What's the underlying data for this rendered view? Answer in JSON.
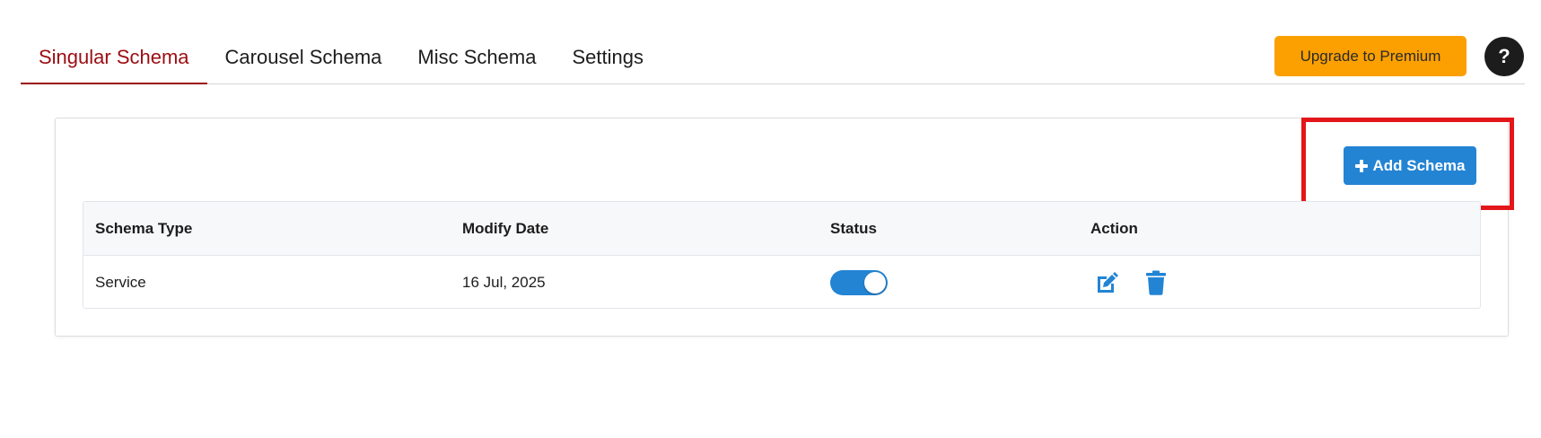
{
  "tabs": [
    {
      "label": "Singular Schema",
      "active": true
    },
    {
      "label": "Carousel Schema",
      "active": false
    },
    {
      "label": "Misc Schema",
      "active": false
    },
    {
      "label": "Settings",
      "active": false
    }
  ],
  "header": {
    "upgrade_label": "Upgrade to Premium",
    "help_label": "?"
  },
  "toolbar": {
    "add_label": "Add Schema"
  },
  "table": {
    "columns": [
      "Schema Type",
      "Modify Date",
      "Status",
      "Action"
    ],
    "rows": [
      {
        "schema_type": "Service",
        "modify_date": "16 Jul, 2025",
        "status_enabled": true
      }
    ]
  },
  "colors": {
    "active_tab": "#9b0d12",
    "upgrade": "#fba000",
    "primary": "#2384d4",
    "highlight": "#e3161a"
  },
  "icons": {
    "add": "plus-icon",
    "edit": "edit-icon",
    "delete": "trash-icon",
    "help": "question-icon"
  }
}
